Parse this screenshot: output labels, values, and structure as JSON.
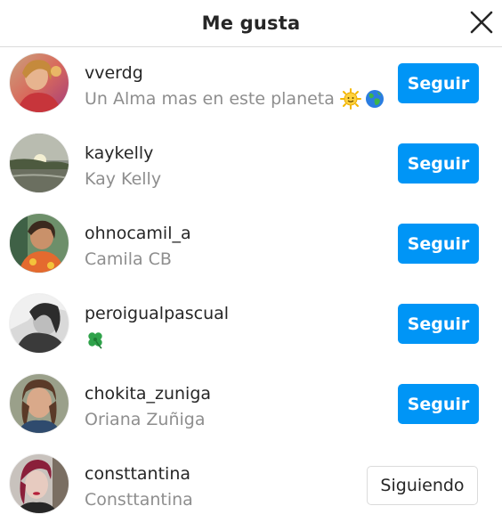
{
  "header": {
    "title": "Me gusta",
    "close_icon": "close-icon"
  },
  "colors": {
    "accent": "#0095f6",
    "text_primary": "#262626",
    "text_secondary": "#8e8e8e",
    "divider": "#dbdbdb"
  },
  "users": [
    {
      "username": "vverdg",
      "fullname": "Un Alma mas en este planeta",
      "emojis": [
        "sun-with-face-emoji",
        "globe-emoji"
      ],
      "button": "Seguir",
      "following": false
    },
    {
      "username": "kaykelly",
      "fullname": "Kay Kelly",
      "emojis": [],
      "button": "Seguir",
      "following": false
    },
    {
      "username": "ohnocamil_a",
      "fullname": "Camila CB",
      "emojis": [],
      "button": "Seguir",
      "following": false
    },
    {
      "username": "peroigualpascual",
      "fullname": "",
      "emojis": [
        "four-leaf-clover-emoji"
      ],
      "button": "Seguir",
      "following": false
    },
    {
      "username": "chokita_zuniga",
      "fullname": "Oriana Zuñiga",
      "emojis": [],
      "button": "Seguir",
      "following": false
    },
    {
      "username": "consttantina",
      "fullname": "Consttantina",
      "emojis": [],
      "button": "Siguiendo",
      "following": true
    }
  ]
}
